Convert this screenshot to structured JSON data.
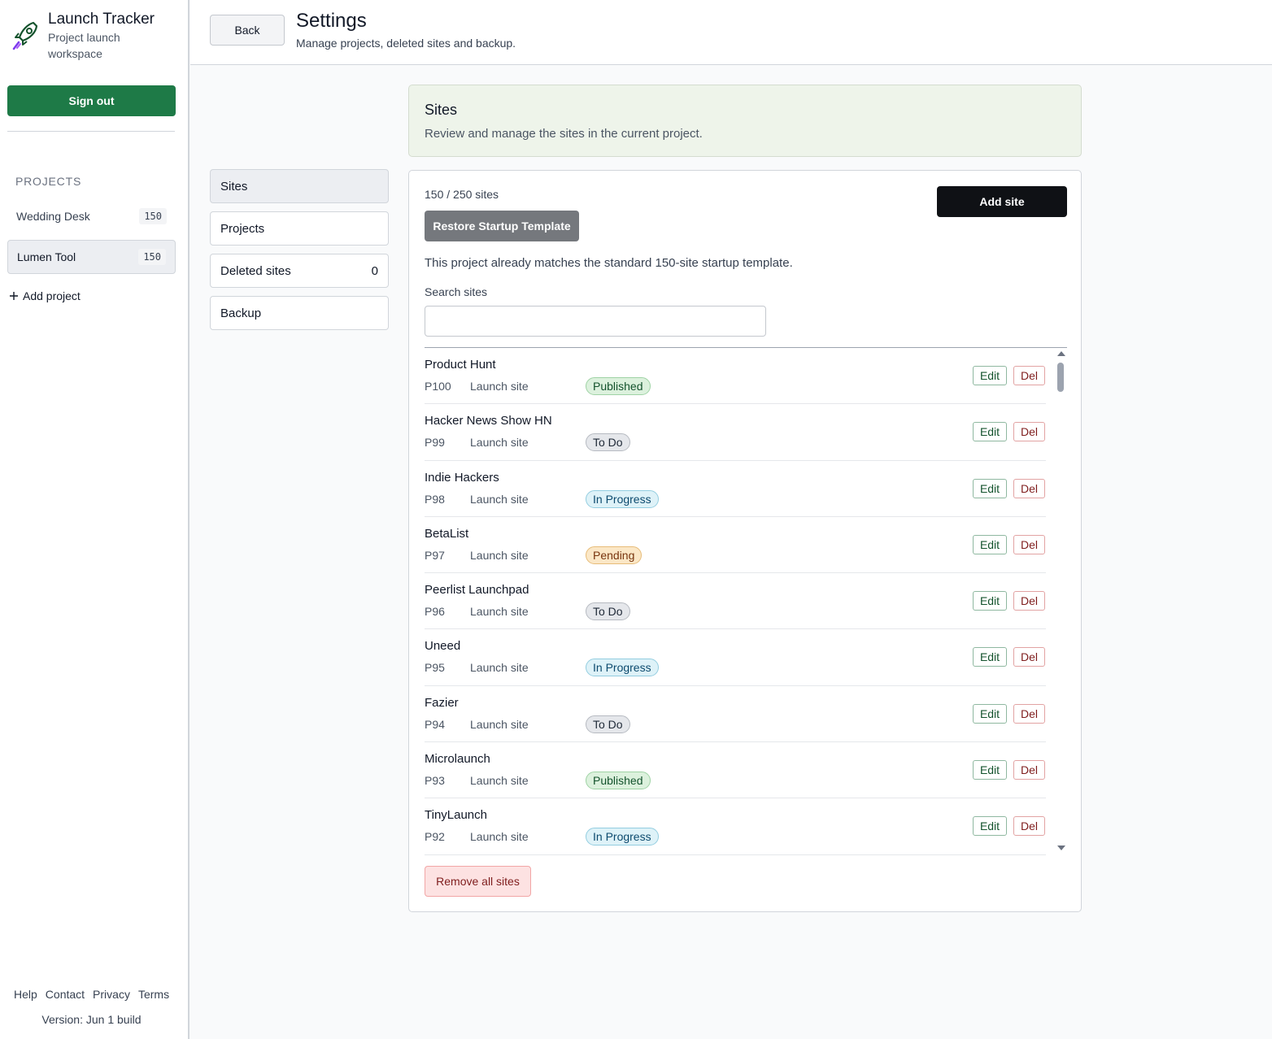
{
  "app": {
    "title": "Launch Tracker",
    "subtitle": "Project launch workspace",
    "logo_icon": "rocket-icon",
    "brand_color": "#1e7a47"
  },
  "sidebar": {
    "signout_label": "Sign out",
    "projects_heading": "PROJECTS",
    "projects": [
      {
        "name": "Wedding Desk",
        "count": "150",
        "active": false
      },
      {
        "name": "Lumen Tool",
        "count": "150",
        "active": true
      }
    ],
    "add_project_icon": "plus-icon",
    "add_project_label": "Add project",
    "footer_links": [
      "Help",
      "Contact",
      "Privacy",
      "Terms"
    ],
    "version": "Version: Jun 1 build"
  },
  "header": {
    "back_label": "Back",
    "title": "Settings",
    "subtitle": "Manage projects, deleted sites and backup."
  },
  "settings_nav": [
    {
      "label": "Sites",
      "count": "",
      "active": true
    },
    {
      "label": "Projects",
      "count": "",
      "active": false
    },
    {
      "label": "Deleted sites",
      "count": "0",
      "active": false
    },
    {
      "label": "Backup",
      "count": "",
      "active": false
    }
  ],
  "sites_section": {
    "title": "Sites",
    "description": "Review and manage the sites in the current project."
  },
  "sites_panel": {
    "count_text": "150 / 250 sites",
    "restore_label": "Restore Startup Template",
    "add_site_label": "Add site",
    "template_note": "This project already matches the standard 150-site startup template.",
    "search_label": "Search sites",
    "search_value": "",
    "edit_label": "Edit",
    "del_label": "Del",
    "remove_all_label": "Remove all sites",
    "sites": [
      {
        "name": "Product Hunt",
        "code": "P100",
        "type": "Launch site",
        "status": "Published",
        "status_kind": "published"
      },
      {
        "name": "Hacker News Show HN",
        "code": "P99",
        "type": "Launch site",
        "status": "To Do",
        "status_kind": "todo"
      },
      {
        "name": "Indie Hackers",
        "code": "P98",
        "type": "Launch site",
        "status": "In Progress",
        "status_kind": "progress"
      },
      {
        "name": "BetaList",
        "code": "P97",
        "type": "Launch site",
        "status": "Pending",
        "status_kind": "pending"
      },
      {
        "name": "Peerlist Launchpad",
        "code": "P96",
        "type": "Launch site",
        "status": "To Do",
        "status_kind": "todo"
      },
      {
        "name": "Uneed",
        "code": "P95",
        "type": "Launch site",
        "status": "In Progress",
        "status_kind": "progress"
      },
      {
        "name": "Fazier",
        "code": "P94",
        "type": "Launch site",
        "status": "To Do",
        "status_kind": "todo"
      },
      {
        "name": "Microlaunch",
        "code": "P93",
        "type": "Launch site",
        "status": "Published",
        "status_kind": "published"
      },
      {
        "name": "TinyLaunch",
        "code": "P92",
        "type": "Launch site",
        "status": "In Progress",
        "status_kind": "progress"
      }
    ]
  }
}
